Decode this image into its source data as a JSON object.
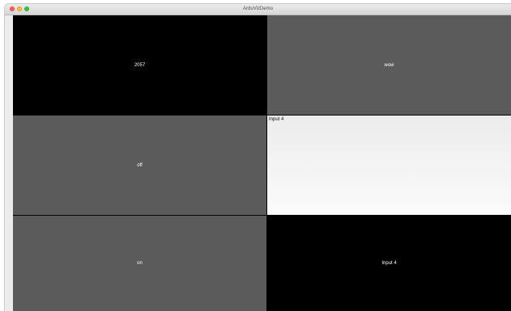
{
  "window": {
    "title": "ArduVizDemo"
  },
  "tiles": {
    "top_left": "2057",
    "top_right": "wow",
    "middle_left": "off",
    "middle_right_label": "Input 4",
    "bottom_left": "on",
    "bottom_right": "Input 4"
  },
  "colors": {
    "dark_tile": "#5b5b5b",
    "black_tile": "#000000",
    "input_bg": "#f4f4f4"
  }
}
